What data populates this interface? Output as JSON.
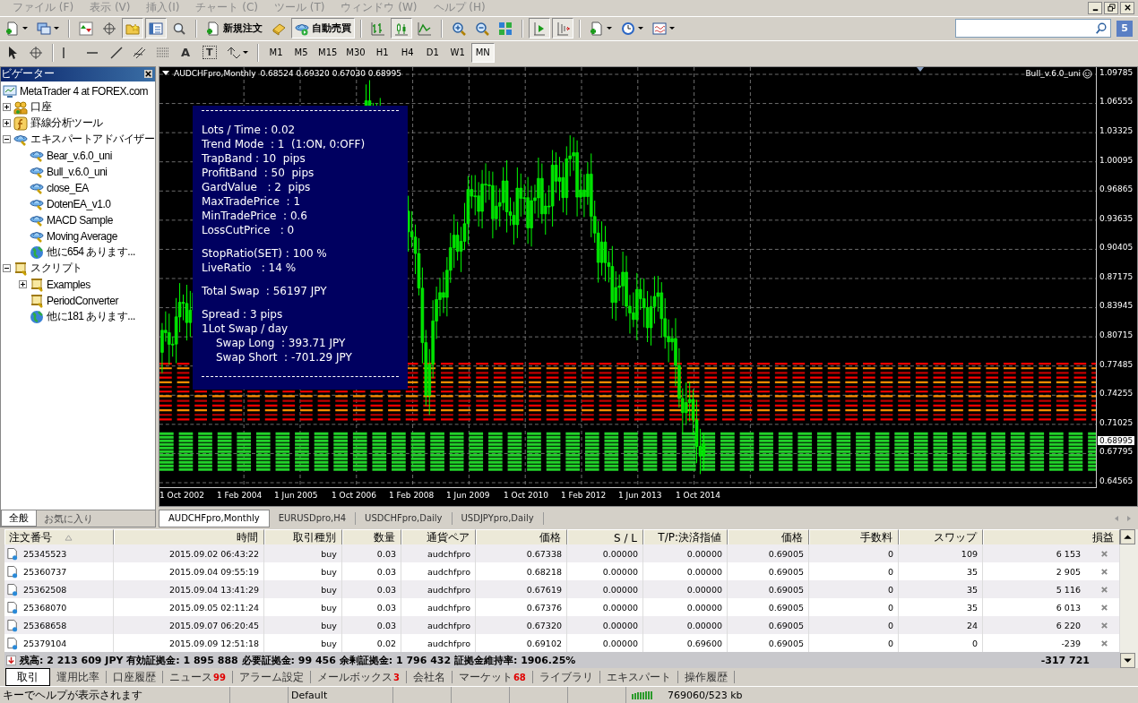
{
  "menu": [
    "ファイル (F)",
    "表示 (V)",
    "挿入(I)",
    "チャート (C)",
    "ツール (T)",
    "ウィンドウ (W)",
    "ヘルプ (H)"
  ],
  "toolbar_main": [
    [
      {
        "kind": "new-chart",
        "pressed": false,
        "caret": true
      },
      {
        "kind": "profiles",
        "pressed": false,
        "caret": true
      }
    ],
    [
      {
        "kind": "market-watch",
        "pressed": false
      },
      {
        "kind": "data-window",
        "pressed": false
      },
      {
        "kind": "navigator",
        "pressed": true
      },
      {
        "kind": "terminal",
        "pressed": true
      },
      {
        "kind": "tester",
        "pressed": false
      }
    ],
    [
      {
        "kind": "new-order",
        "label": "新規注文",
        "pressed": false
      },
      {
        "kind": "editor",
        "pressed": false
      },
      {
        "kind": "auto-trading",
        "label": "自動売買",
        "pressed": true
      }
    ],
    [
      {
        "kind": "bars",
        "pressed": false
      },
      {
        "kind": "candles",
        "pressed": true
      },
      {
        "kind": "line",
        "pressed": false
      }
    ],
    [
      {
        "kind": "zoom-in",
        "pressed": false
      },
      {
        "kind": "zoom-out",
        "pressed": false
      },
      {
        "kind": "tile",
        "pressed": false
      }
    ],
    [
      {
        "kind": "auto-scroll",
        "pressed": true
      },
      {
        "kind": "chart-shift",
        "pressed": true
      }
    ],
    [
      {
        "kind": "indicators",
        "pressed": false,
        "caret": true
      },
      {
        "kind": "periods",
        "pressed": false,
        "caret": true
      },
      {
        "kind": "templates",
        "pressed": false,
        "caret": true
      }
    ]
  ],
  "toolbar_draw": [
    [
      {
        "kind": "cursor",
        "pressed": false
      },
      {
        "kind": "crosshair",
        "pressed": false
      }
    ],
    [
      {
        "kind": "vertical-line",
        "pressed": false
      },
      {
        "kind": "horizontal-line",
        "pressed": false
      },
      {
        "kind": "trend-line",
        "pressed": false
      },
      {
        "kind": "channel",
        "pressed": false
      },
      {
        "kind": "fibonacci",
        "pressed": false
      },
      {
        "kind": "text",
        "label": "A",
        "pressed": false
      },
      {
        "kind": "label",
        "label": "T",
        "pressed": false
      },
      {
        "kind": "arrows",
        "pressed": false,
        "caret": true
      }
    ]
  ],
  "timeframes": [
    {
      "label": "M1",
      "selected": false
    },
    {
      "label": "M5",
      "selected": false
    },
    {
      "label": "M15",
      "selected": false
    },
    {
      "label": "M30",
      "selected": false
    },
    {
      "label": "H1",
      "selected": false
    },
    {
      "label": "H4",
      "selected": false
    },
    {
      "label": "D1",
      "selected": false
    },
    {
      "label": "W1",
      "selected": false
    },
    {
      "label": "MN",
      "selected": true
    }
  ],
  "search": {
    "badge": "5"
  },
  "navigator": {
    "title": "ビゲーター",
    "tree": {
      "label": "MetaTrader 4 at FOREX.com",
      "kind": "terminal",
      "children": [
        {
          "label": "口座",
          "kind": "accounts",
          "expanded": false
        },
        {
          "label": "罫線分析ツール",
          "kind": "indicators",
          "expanded": false
        },
        {
          "label": "エキスパートアドバイザー",
          "kind": "experts",
          "expanded": true,
          "children": [
            {
              "label": "Bear_v.6.0_uni",
              "kind": "expert"
            },
            {
              "label": "Bull_v.6.0_uni",
              "kind": "expert"
            },
            {
              "label": "close_EA",
              "kind": "expert"
            },
            {
              "label": "DotenEA_v1.0",
              "kind": "expert"
            },
            {
              "label": "MACD Sample",
              "kind": "expert"
            },
            {
              "label": "Moving Average",
              "kind": "expert"
            },
            {
              "label": "他に654 あります...",
              "kind": "more"
            }
          ]
        },
        {
          "label": "スクリプト",
          "kind": "scripts",
          "expanded": true,
          "children": [
            {
              "label": "Examples",
              "kind": "script",
              "expanded": false
            },
            {
              "label": "PeriodConverter",
              "kind": "script"
            },
            {
              "label": "他に181 あります...",
              "kind": "more"
            }
          ]
        }
      ]
    },
    "tabs": [
      {
        "label": "全般",
        "selected": true
      },
      {
        "label": "お気に入り",
        "selected": false
      }
    ]
  },
  "chart": {
    "title": "AUDCHFpro,Monthly",
    "ohlc": "0.68524 0.69320 0.67030 0.68995",
    "expert": "Bull_v.6.0_uni",
    "price_labels": [
      "1.09785",
      "1.06555",
      "1.03325",
      "1.00095",
      "0.96865",
      "0.93635",
      "0.90405",
      "0.87175",
      "0.83945",
      "0.80715",
      "0.77485",
      "0.74255",
      "0.71025",
      "0.67795",
      "0.64565"
    ],
    "current_price": "0.68995",
    "time_labels": [
      "1 Oct 2002",
      "1 Feb 2004",
      "1 Jun 2005",
      "1 Oct 2006",
      "1 Feb 2008",
      "1 Jun 2009",
      "1 Oct 2010",
      "1 Feb 2012",
      "1 Jun 2013",
      "1 Oct 2014"
    ],
    "info_blocks": [
      [
        {
          "text": "Lots / Time : 0.02",
          "indent": false
        },
        {
          "text": "Trend Mode  : 1  (1:ON, 0:OFF)",
          "indent": false
        },
        {
          "text": "TrapBand : 10  pips",
          "indent": false
        },
        {
          "text": "ProfitBand  : 50  pips",
          "indent": false
        },
        {
          "text": "GardValue   : 2  pips",
          "indent": false
        },
        {
          "text": "MaxTradePrice  : 1",
          "indent": false
        },
        {
          "text": "MinTradePrice  : 0.6",
          "indent": false
        },
        {
          "text": "LossCutPrice   : 0",
          "indent": false
        }
      ],
      [
        {
          "text": "StopRatio(SET) : 100 %",
          "indent": false
        },
        {
          "text": "LiveRatio   : 14 %",
          "indent": false
        }
      ],
      [
        {
          "text": "Total Swap  : 56197 JPY",
          "indent": false
        }
      ],
      [
        {
          "text": "Spread : 3 pips",
          "indent": false
        },
        {
          "text": "1Lot Swap / day",
          "indent": false
        },
        {
          "text": "Swap Long  : 393.71 JPY",
          "indent": true
        },
        {
          "text": "Swap Short  : -701.29 JPY",
          "indent": true
        }
      ]
    ]
  },
  "chart_tabs": [
    {
      "label": "AUDCHFpro,Monthly",
      "selected": true
    },
    {
      "label": "EURUSDpro,H4",
      "selected": false
    },
    {
      "label": "USDCHFpro,Daily",
      "selected": false
    },
    {
      "label": "USDJPYpro,Daily",
      "selected": false
    }
  ],
  "terminal": {
    "columns": [
      "注文番号",
      "時間",
      "取引種別",
      "数量",
      "通貨ペア",
      "価格",
      "S / L",
      "T/P:決済指値",
      "価格",
      "手数料",
      "スワップ",
      "損益"
    ],
    "rows": [
      [
        "25345523",
        "2015.09.02 06:43:22",
        "buy",
        "0.03",
        "audchfpro",
        "0.67338",
        "0.00000",
        "0.00000",
        "0.69005",
        "0",
        "109",
        "6 153"
      ],
      [
        "25360737",
        "2015.09.04 09:55:19",
        "buy",
        "0.03",
        "audchfpro",
        "0.68218",
        "0.00000",
        "0.00000",
        "0.69005",
        "0",
        "35",
        "2 905"
      ],
      [
        "25362508",
        "2015.09.04 13:41:29",
        "buy",
        "0.03",
        "audchfpro",
        "0.67619",
        "0.00000",
        "0.00000",
        "0.69005",
        "0",
        "35",
        "5 116"
      ],
      [
        "25368070",
        "2015.09.05 02:11:24",
        "buy",
        "0.03",
        "audchfpro",
        "0.67376",
        "0.00000",
        "0.00000",
        "0.69005",
        "0",
        "35",
        "6 013"
      ],
      [
        "25368658",
        "2015.09.07 06:20:45",
        "buy",
        "0.03",
        "audchfpro",
        "0.67320",
        "0.00000",
        "0.00000",
        "0.69005",
        "0",
        "24",
        "6 220"
      ],
      [
        "25379104",
        "2015.09.09 12:51:18",
        "buy",
        "0.02",
        "audchfpro",
        "0.69102",
        "0.00000",
        "0.69600",
        "0.69005",
        "0",
        "0",
        "-239"
      ]
    ],
    "summary": "残高: 2 213 609 JPY  有効証拠金: 1 895 888  必要証拠金: 99 456  余剰証拠金: 1 796 432  証拠金維持率: 1906.25%",
    "total": "-317 721",
    "tabs": [
      {
        "label": "取引",
        "selected": true
      },
      {
        "label": "運用比率",
        "selected": false
      },
      {
        "label": "口座履歴",
        "selected": false
      },
      {
        "label": "ニュース",
        "count": "99",
        "selected": false
      },
      {
        "label": "アラーム設定",
        "selected": false
      },
      {
        "label": "メールボックス",
        "count": "3",
        "selected": false
      },
      {
        "label": "会社名",
        "selected": false
      },
      {
        "label": "マーケット",
        "count": "68",
        "selected": false
      },
      {
        "label": "ライブラリ",
        "selected": false
      },
      {
        "label": "エキスパート",
        "selected": false
      },
      {
        "label": "操作履歴",
        "selected": false
      }
    ]
  },
  "status_bar": {
    "help": "キーでヘルプが表示されます",
    "profile": "Default",
    "traffic": "769060/523 kb"
  }
}
